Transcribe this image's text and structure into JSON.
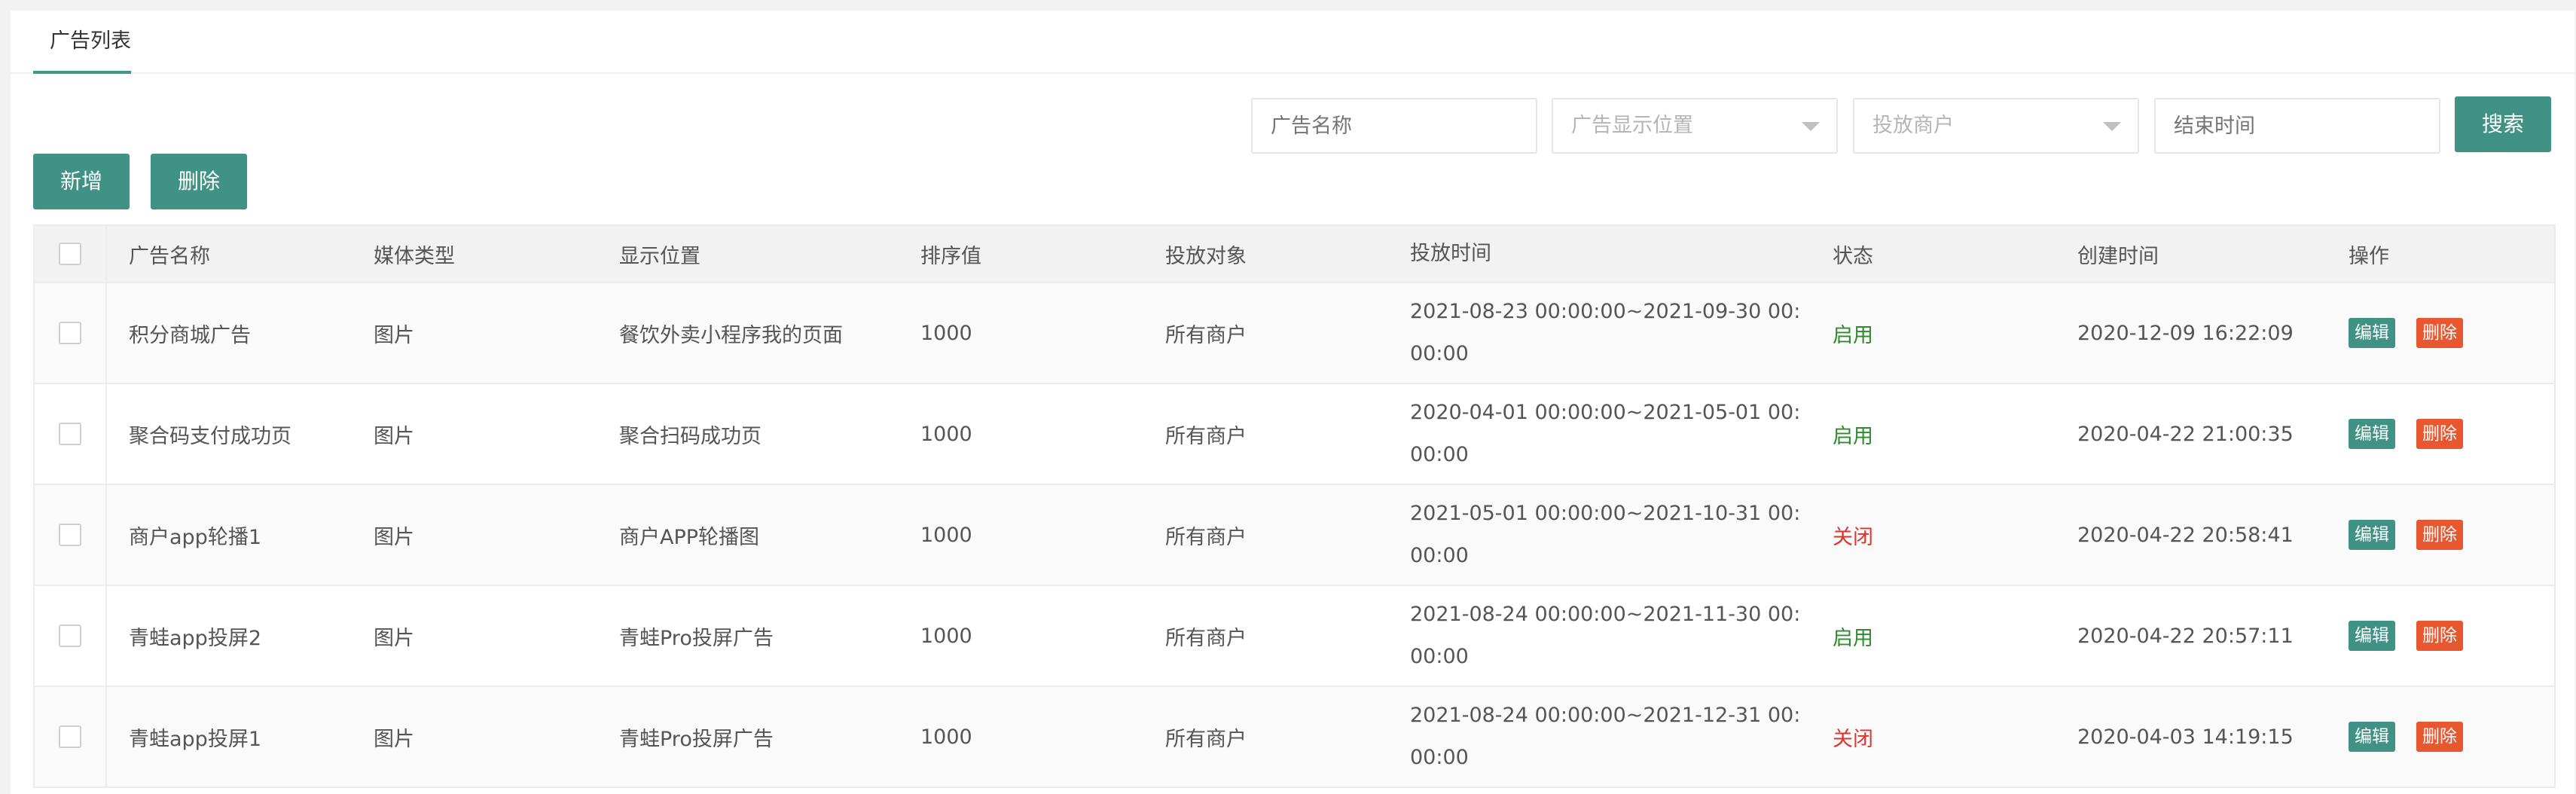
{
  "tab": {
    "label": "广告列表"
  },
  "filters": {
    "ad_name_placeholder": "广告名称",
    "position_placeholder": "广告显示位置",
    "merchant_placeholder": "投放商户",
    "end_time_placeholder": "结束时间",
    "search_label": "搜索"
  },
  "toolbar": {
    "add_label": "新增",
    "delete_label": "删除"
  },
  "table": {
    "headers": [
      "广告名称",
      "媒体类型",
      "显示位置",
      "排序值",
      "投放对象",
      "投放时间",
      "状态",
      "创建时间",
      "操作"
    ],
    "rows": [
      {
        "name": "积分商城广告",
        "media": "图片",
        "position": "餐饮外卖小程序我的页面",
        "sort": "1000",
        "target": "所有商户",
        "time": "2021-08-23 00:00:00~2021-09-30 00:00:00",
        "status": "启用",
        "created": "2020-12-09 16:22:09",
        "edit": "编辑",
        "delete": "删除"
      },
      {
        "name": "聚合码支付成功页",
        "media": "图片",
        "position": "聚合扫码成功页",
        "sort": "1000",
        "target": "所有商户",
        "time": "2020-04-01 00:00:00~2021-05-01 00:00:00",
        "status": "启用",
        "created": "2020-04-22 21:00:35",
        "edit": "编辑",
        "delete": "删除"
      },
      {
        "name": "商户app轮播1",
        "media": "图片",
        "position": "商户APP轮播图",
        "sort": "1000",
        "target": "所有商户",
        "time": "2021-05-01 00:00:00~2021-10-31 00:00:00",
        "status": "关闭",
        "created": "2020-04-22 20:58:41",
        "edit": "编辑",
        "delete": "删除"
      },
      {
        "name": "青蛙app投屏2",
        "media": "图片",
        "position": "青蛙Pro投屏广告",
        "sort": "1000",
        "target": "所有商户",
        "time": "2021-08-24 00:00:00~2021-11-30 00:00:00",
        "status": "启用",
        "created": "2020-04-22 20:57:11",
        "edit": "编辑",
        "delete": "删除"
      },
      {
        "name": "青蛙app投屏1",
        "media": "图片",
        "position": "青蛙Pro投屏广告",
        "sort": "1000",
        "target": "所有商户",
        "time": "2021-08-24 00:00:00~2021-12-31 00:00:00",
        "status": "关闭",
        "created": "2020-04-03 14:19:15",
        "edit": "编辑",
        "delete": "删除"
      }
    ]
  }
}
